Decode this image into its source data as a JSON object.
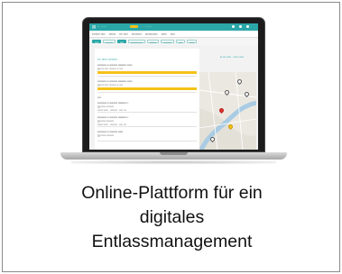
{
  "caption": {
    "line1": "Online-Plattform für ein",
    "line2": "digitales",
    "line3": "Entlassmanagement"
  },
  "colors": {
    "accent": "#2ba7a8",
    "highlight": "#f5c218",
    "marker": "#e0312b",
    "border": "#8a8a8a"
  },
  "icons": [
    "laptop-icon",
    "map-pin-icon"
  ]
}
